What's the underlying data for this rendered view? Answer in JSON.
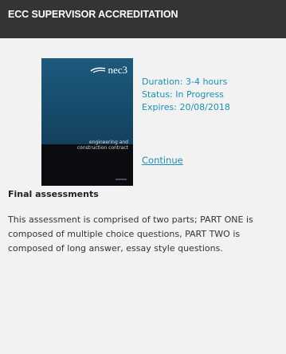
{
  "card": {
    "title": "ECC SUPERVISOR ACCREDITATION",
    "cover": {
      "logo_text": "nec3",
      "subtitle_line1": "engineering and",
      "subtitle_line2": "construction contract"
    },
    "meta": {
      "duration": "Duration: 3-4 hours",
      "status": "Status: In Progress",
      "expires": "Expires: 20/08/2018"
    },
    "continue_label": "Continue",
    "section_heading": "Final assessments",
    "description": "This assessment is comprised of two parts; PART ONE is composed of multiple choice questions, PART TWO is composed of long answer, essay style questions."
  },
  "colors": {
    "header_bg": "#333436",
    "card_bg": "#f2f2f2",
    "link": "#1e8fb0",
    "text": "#333333"
  },
  "icons": {
    "cover_logo": "nec3-logo-icon"
  }
}
